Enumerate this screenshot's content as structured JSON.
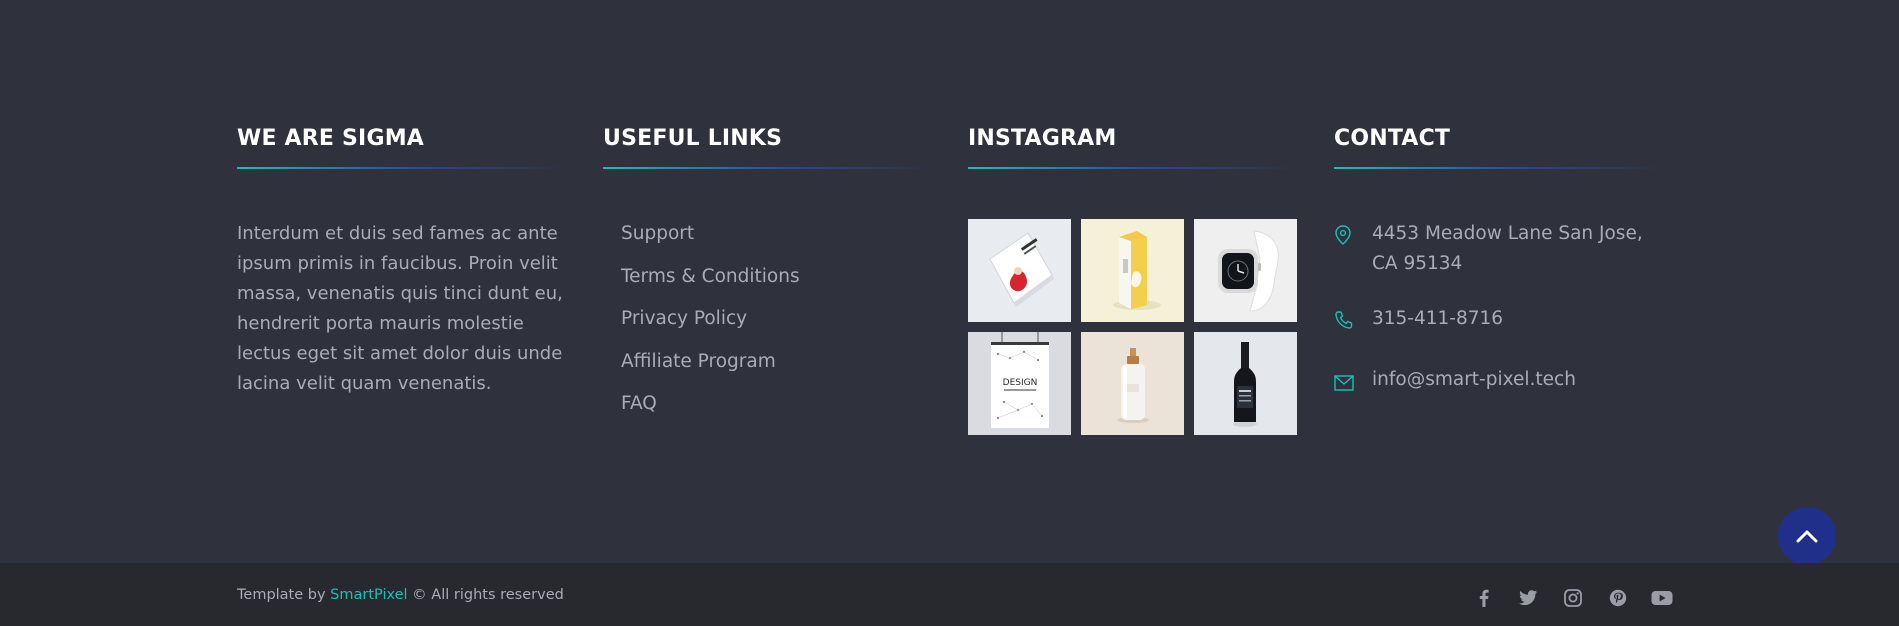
{
  "about": {
    "title": "WE ARE SIGMA",
    "text": "Interdum et duis sed fames ac ante ipsum primis in faucibus. Proin velit massa, venenatis quis tinci dunt eu, hendrerit porta mauris molestie lectus eget sit amet dolor duis unde lacina velit quam venenatis."
  },
  "links": {
    "title": "USEFUL LINKS",
    "items": [
      "Support",
      "Terms & Conditions",
      "Privacy Policy",
      "Affiliate Program",
      "FAQ"
    ]
  },
  "instagram": {
    "title": "INSTAGRAM",
    "items": [
      {
        "name": "book-thumbnail",
        "bg": "#e8ebef"
      },
      {
        "name": "box-thumbnail",
        "bg": "#f4f1d8"
      },
      {
        "name": "watch-thumbnail",
        "bg": "#efefef"
      },
      {
        "name": "poster-thumbnail",
        "bg": "#d9dbe0",
        "text": "DESIGN"
      },
      {
        "name": "bottle-thumbnail",
        "bg": "#ece3d8"
      },
      {
        "name": "wine-thumbnail",
        "bg": "#e4e7ec"
      }
    ]
  },
  "contact": {
    "title": "CONTACT",
    "address": "4453 Meadow Lane San Jose, CA 95134",
    "phone": "315-411-8716",
    "email": "info@smart-pixel.tech"
  },
  "footer": {
    "prefix": "Template by ",
    "brand": "SmartPixel",
    "suffix": " © All rights reserved",
    "socials": [
      "facebook-icon",
      "twitter-icon",
      "instagram-icon",
      "pinterest-icon",
      "youtube-icon"
    ]
  },
  "colors": {
    "background": "#2f323d",
    "bottom_bar": "#27292f",
    "accent": "#19c0b8",
    "scroll_button": "#1f2f8a"
  }
}
